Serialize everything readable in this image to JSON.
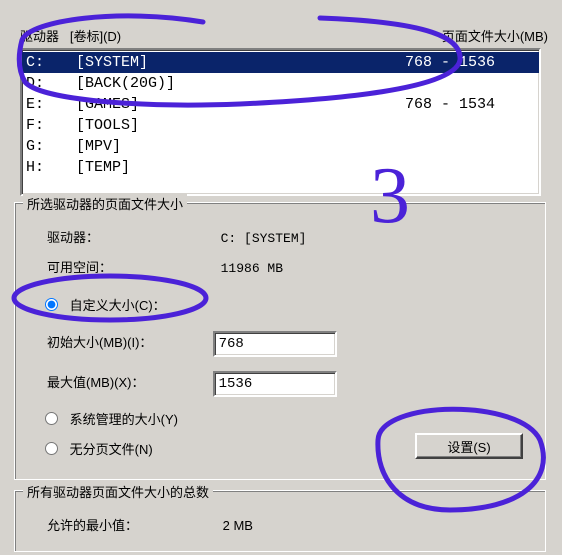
{
  "header": {
    "drive_label_col": "驱动器",
    "volume_col": "[卷标]",
    "volume_key": "(D)",
    "size_col": "页面文件大小(MB)"
  },
  "drives": [
    {
      "letter": "C:",
      "label": "[SYSTEM]",
      "size": "768 - 1536",
      "selected": true
    },
    {
      "letter": "D:",
      "label": "[BACK(20G)]",
      "size": "",
      "selected": false
    },
    {
      "letter": "E:",
      "label": "[GAMES]",
      "size": "768 - 1534",
      "selected": false
    },
    {
      "letter": "F:",
      "label": "[TOOLS]",
      "size": "",
      "selected": false
    },
    {
      "letter": "G:",
      "label": "[MPV]",
      "size": "",
      "selected": false
    },
    {
      "letter": "H:",
      "label": "[TEMP]",
      "size": "",
      "selected": false
    }
  ],
  "group1": {
    "title": "所选驱动器的页面文件大小",
    "drive_label": "驱动器：",
    "drive_value": "C:  [SYSTEM]",
    "avail_label": "可用空间：",
    "avail_value": "11986 MB",
    "radio_custom": "自定义大小(C)：",
    "radio_system": "系统管理的大小(Y)",
    "radio_none": "无分页文件(N)",
    "initial_label": "初始大小(MB)(I)：",
    "initial_value": "768",
    "max_label": "最大值(MB)(X)：",
    "max_value": "1536",
    "set_button": "设置(S)"
  },
  "group2": {
    "title": "所有驱动器页面文件大小的总数",
    "min_label": "允许的最小值：",
    "min_value": "2 MB"
  },
  "annotation_number": "3"
}
